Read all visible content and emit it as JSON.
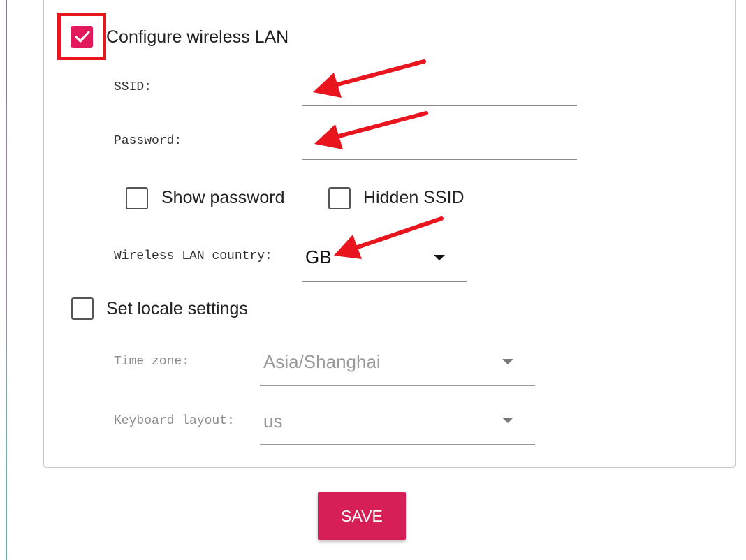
{
  "wifi": {
    "configure_label": "Configure wireless LAN",
    "configure_checked": true,
    "ssid_label": "SSID:",
    "ssid_value": "",
    "password_label": "Password:",
    "password_value": "",
    "show_password_label": "Show password",
    "hidden_ssid_label": "Hidden SSID",
    "country_label": "Wireless LAN country:",
    "country_value": "GB"
  },
  "locale": {
    "set_locale_label": "Set locale settings",
    "set_locale_checked": false,
    "timezone_label": "Time zone:",
    "timezone_value": "Asia/Shanghai",
    "keyboard_label": "Keyboard layout:",
    "keyboard_value": "us"
  },
  "actions": {
    "save_label": "SAVE"
  },
  "colors": {
    "accent": "#e2195a",
    "annotation": "#e8151f",
    "save_button": "#d61f57"
  },
  "icons": [
    "checkmark-icon",
    "chevron-down-icon",
    "annotation-arrow-icon"
  ]
}
